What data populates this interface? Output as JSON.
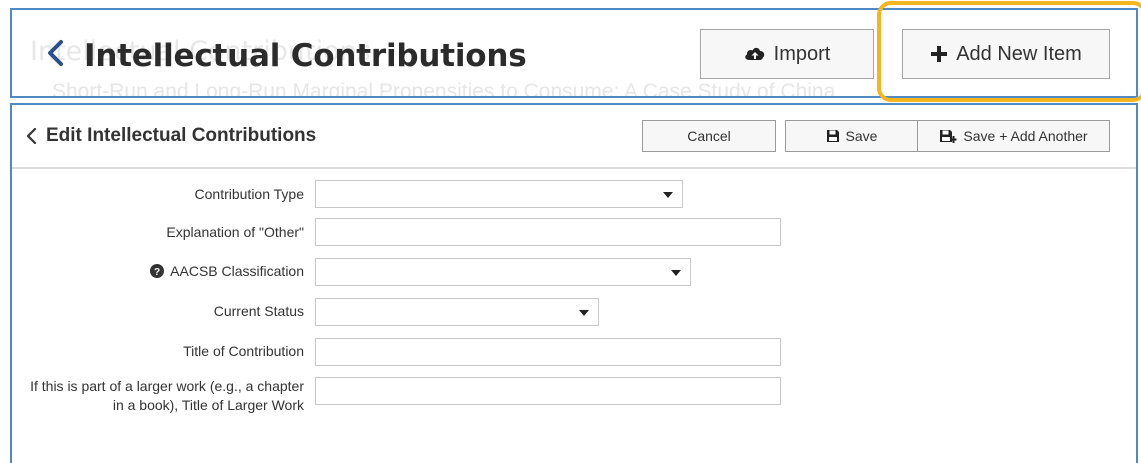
{
  "header": {
    "ghost_title": "Intellectual Contributions",
    "ghost_subtitle": "Short-Run and Long-Run Marginal Propensities to Consume: A Case Study of China",
    "title": "Intellectual Contributions",
    "import_label": "Import",
    "add_label": "Add New Item"
  },
  "edit": {
    "title": "Edit Intellectual Contributions",
    "cancel_label": "Cancel",
    "save_label": "Save",
    "save_add_label": "Save + Add Another"
  },
  "form": {
    "contribution_type": {
      "label": "Contribution Type",
      "value": ""
    },
    "explanation_other": {
      "label": "Explanation of \"Other\"",
      "value": ""
    },
    "aacsb": {
      "label": "AACSB Classification",
      "value": ""
    },
    "current_status": {
      "label": "Current Status",
      "value": ""
    },
    "title_contribution": {
      "label": "Title of Contribution",
      "value": ""
    },
    "larger_work": {
      "label": "If this is part of a larger work (e.g., a chapter in a book), Title of Larger Work",
      "value": ""
    }
  },
  "colors": {
    "accent_border": "#4f8ac4",
    "highlight": "#f4b61c"
  },
  "icons": [
    "chevron-left-icon",
    "cloud-upload-icon",
    "plus-icon",
    "floppy-disk-icon",
    "floppy-disk-plus-icon",
    "question-circle-icon",
    "caret-down-icon"
  ]
}
